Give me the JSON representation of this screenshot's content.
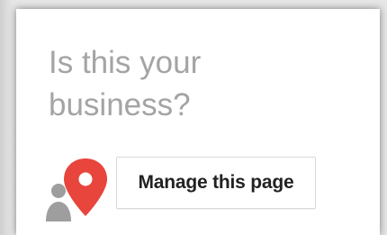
{
  "card": {
    "title_line1": "Is this your",
    "title_line2": "business?",
    "manage_button_label": "Manage this page",
    "icon": "person-with-map-pin-icon"
  },
  "colors": {
    "title": "#a4a4a4",
    "pin": "#e8453c",
    "person": "#9e9e9e",
    "button_text": "#222222"
  }
}
